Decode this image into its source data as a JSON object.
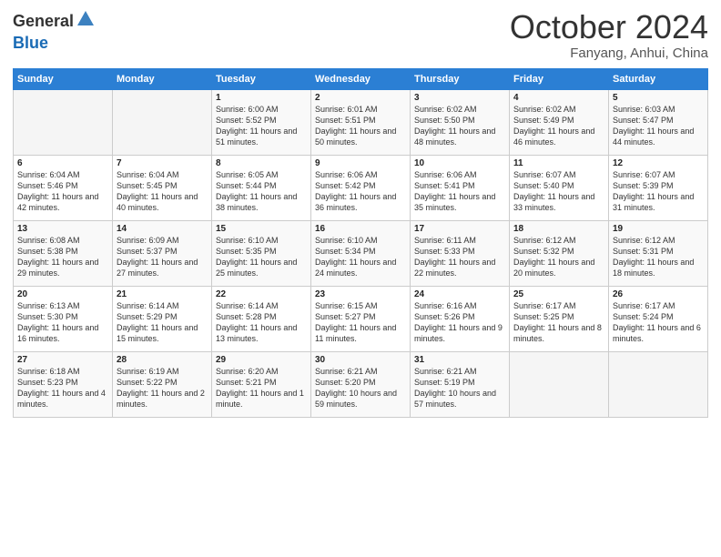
{
  "header": {
    "logo_general": "General",
    "logo_blue": "Blue",
    "month_title": "October 2024",
    "location": "Fanyang, Anhui, China"
  },
  "days_of_week": [
    "Sunday",
    "Monday",
    "Tuesday",
    "Wednesday",
    "Thursday",
    "Friday",
    "Saturday"
  ],
  "weeks": [
    [
      {
        "day": "",
        "info": ""
      },
      {
        "day": "",
        "info": ""
      },
      {
        "day": "1",
        "info": "Sunrise: 6:00 AM\nSunset: 5:52 PM\nDaylight: 11 hours and 51 minutes."
      },
      {
        "day": "2",
        "info": "Sunrise: 6:01 AM\nSunset: 5:51 PM\nDaylight: 11 hours and 50 minutes."
      },
      {
        "day": "3",
        "info": "Sunrise: 6:02 AM\nSunset: 5:50 PM\nDaylight: 11 hours and 48 minutes."
      },
      {
        "day": "4",
        "info": "Sunrise: 6:02 AM\nSunset: 5:49 PM\nDaylight: 11 hours and 46 minutes."
      },
      {
        "day": "5",
        "info": "Sunrise: 6:03 AM\nSunset: 5:47 PM\nDaylight: 11 hours and 44 minutes."
      }
    ],
    [
      {
        "day": "6",
        "info": "Sunrise: 6:04 AM\nSunset: 5:46 PM\nDaylight: 11 hours and 42 minutes."
      },
      {
        "day": "7",
        "info": "Sunrise: 6:04 AM\nSunset: 5:45 PM\nDaylight: 11 hours and 40 minutes."
      },
      {
        "day": "8",
        "info": "Sunrise: 6:05 AM\nSunset: 5:44 PM\nDaylight: 11 hours and 38 minutes."
      },
      {
        "day": "9",
        "info": "Sunrise: 6:06 AM\nSunset: 5:42 PM\nDaylight: 11 hours and 36 minutes."
      },
      {
        "day": "10",
        "info": "Sunrise: 6:06 AM\nSunset: 5:41 PM\nDaylight: 11 hours and 35 minutes."
      },
      {
        "day": "11",
        "info": "Sunrise: 6:07 AM\nSunset: 5:40 PM\nDaylight: 11 hours and 33 minutes."
      },
      {
        "day": "12",
        "info": "Sunrise: 6:07 AM\nSunset: 5:39 PM\nDaylight: 11 hours and 31 minutes."
      }
    ],
    [
      {
        "day": "13",
        "info": "Sunrise: 6:08 AM\nSunset: 5:38 PM\nDaylight: 11 hours and 29 minutes."
      },
      {
        "day": "14",
        "info": "Sunrise: 6:09 AM\nSunset: 5:37 PM\nDaylight: 11 hours and 27 minutes."
      },
      {
        "day": "15",
        "info": "Sunrise: 6:10 AM\nSunset: 5:35 PM\nDaylight: 11 hours and 25 minutes."
      },
      {
        "day": "16",
        "info": "Sunrise: 6:10 AM\nSunset: 5:34 PM\nDaylight: 11 hours and 24 minutes."
      },
      {
        "day": "17",
        "info": "Sunrise: 6:11 AM\nSunset: 5:33 PM\nDaylight: 11 hours and 22 minutes."
      },
      {
        "day": "18",
        "info": "Sunrise: 6:12 AM\nSunset: 5:32 PM\nDaylight: 11 hours and 20 minutes."
      },
      {
        "day": "19",
        "info": "Sunrise: 6:12 AM\nSunset: 5:31 PM\nDaylight: 11 hours and 18 minutes."
      }
    ],
    [
      {
        "day": "20",
        "info": "Sunrise: 6:13 AM\nSunset: 5:30 PM\nDaylight: 11 hours and 16 minutes."
      },
      {
        "day": "21",
        "info": "Sunrise: 6:14 AM\nSunset: 5:29 PM\nDaylight: 11 hours and 15 minutes."
      },
      {
        "day": "22",
        "info": "Sunrise: 6:14 AM\nSunset: 5:28 PM\nDaylight: 11 hours and 13 minutes."
      },
      {
        "day": "23",
        "info": "Sunrise: 6:15 AM\nSunset: 5:27 PM\nDaylight: 11 hours and 11 minutes."
      },
      {
        "day": "24",
        "info": "Sunrise: 6:16 AM\nSunset: 5:26 PM\nDaylight: 11 hours and 9 minutes."
      },
      {
        "day": "25",
        "info": "Sunrise: 6:17 AM\nSunset: 5:25 PM\nDaylight: 11 hours and 8 minutes."
      },
      {
        "day": "26",
        "info": "Sunrise: 6:17 AM\nSunset: 5:24 PM\nDaylight: 11 hours and 6 minutes."
      }
    ],
    [
      {
        "day": "27",
        "info": "Sunrise: 6:18 AM\nSunset: 5:23 PM\nDaylight: 11 hours and 4 minutes."
      },
      {
        "day": "28",
        "info": "Sunrise: 6:19 AM\nSunset: 5:22 PM\nDaylight: 11 hours and 2 minutes."
      },
      {
        "day": "29",
        "info": "Sunrise: 6:20 AM\nSunset: 5:21 PM\nDaylight: 11 hours and 1 minute."
      },
      {
        "day": "30",
        "info": "Sunrise: 6:21 AM\nSunset: 5:20 PM\nDaylight: 10 hours and 59 minutes."
      },
      {
        "day": "31",
        "info": "Sunrise: 6:21 AM\nSunset: 5:19 PM\nDaylight: 10 hours and 57 minutes."
      },
      {
        "day": "",
        "info": ""
      },
      {
        "day": "",
        "info": ""
      }
    ]
  ]
}
